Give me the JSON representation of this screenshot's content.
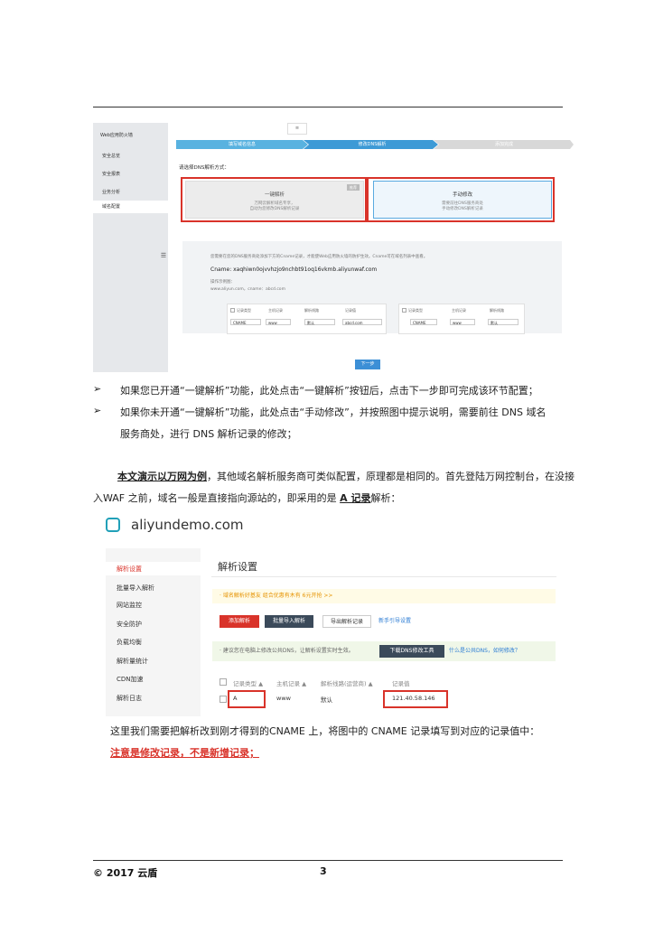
{
  "shot1": {
    "top_tab": "≡",
    "side_title": "Web应用防火墙",
    "side_items": [
      "安全总览",
      "安全报表",
      "业务分析",
      "域名配置"
    ],
    "side_toggle": "☰",
    "steps": [
      "填写域名信息",
      "修改DNS解析",
      "添加完成"
    ],
    "prompt": "请选择DNS解析方式：",
    "opt1_title": "一键解析",
    "opt1_line1": "万网云解析域名专享，",
    "opt1_line2": "自动为您修改DNS解析记录",
    "opt1_badge": "推荐",
    "opt2_title": "手动修改",
    "opt2_line1": "需要前往DNS服务商处",
    "opt2_line2": "手动修改DNS解析记录",
    "info_line1": "您需要在您的DNS服务商处添加下方的Cname记录，才能使Web应用防火墙的防护生效。Cname可在域名列表中查看。",
    "cname": "Cname: xaqhiwn0ojvvhzjo9nchbt91oq16vkmb.aliyunwaf.com",
    "example_label": "操作示例图：",
    "example_value": "www.aliyun.com，cname：abcd.com",
    "table_headers_left": [
      "记录类型",
      "主机记录",
      "解析线路",
      "记录值"
    ],
    "table_headers_right": [
      "记录类型",
      "主机记录",
      "解析线路"
    ],
    "cells_left": [
      "CNAME",
      "www",
      "默认",
      "abcd.com"
    ],
    "cells_right": [
      "CNAME",
      "www",
      "默认"
    ],
    "next_button": "下一步"
  },
  "bullets": [
    "如果您已开通“一键解析”功能，此处点击“一键解析”按钮后，点击下一步即可完成该环节配置；",
    "如果你未开通“一键解析”功能，此处点击“手动修改”，并按照图中提示说明，需要前往 DNS 域名"
  ],
  "bullet2_cont": "服务商处，进行 DNS 解析记录的修改；",
  "para1_bold": "本文演示以万网为例",
  "para1_rest": "，其他域名解析服务商可类似配置，原理都是相同的。首先登陆万网控制台，在没接",
  "para2_prefix": "入WAF 之前，域名一般是直接指向源站的，即采用的是 ",
  "para2_bold": "A 记录",
  "para2_suffix": "解析：",
  "shot2": {
    "brand": "aliyundemo.com",
    "side_items": [
      "解析设置",
      "批量导入解析",
      "网站监控",
      "安全防护",
      "负载均衡",
      "解析量统计",
      "CDN加速",
      "解析日志"
    ],
    "title": "解析设置",
    "notice1": "· 域名解析好基友 组合优惠有木有 6元开抢 >>",
    "btn_add": "添加解析",
    "btn_import": "批量导入解析",
    "btn_export": "导出解析记录",
    "link_guide": "新手引导设置",
    "notice2": "· 建议您在电脑上修改公共DNS，让解析设置实时生效。",
    "btn_download": "下载DNS修改工具",
    "link_what": "什么是公共DNS，如何修改？",
    "headers": [
      "记录类型 ▲",
      "主机记录 ▲",
      "解析线路(运营商) ▲",
      "记录值"
    ],
    "row": [
      "A",
      "www",
      "默认",
      "121.40.58.146"
    ]
  },
  "para3": "这里我们需要把解析改到刚才得到的CNAME 上，将图中的 CNAME 记录填写到对应的记录值中：",
  "para4": "注意是修改记录，不是新增记录；",
  "footer": {
    "left": "© 2017  云盾",
    "page": "3"
  },
  "colors": {
    "accent_red": "#d9332a",
    "accent_blue": "#3c8fd6",
    "step_done": "#58b2e0",
    "step_active": "#3d9ad6",
    "step_pending": "#d8d8d8"
  }
}
